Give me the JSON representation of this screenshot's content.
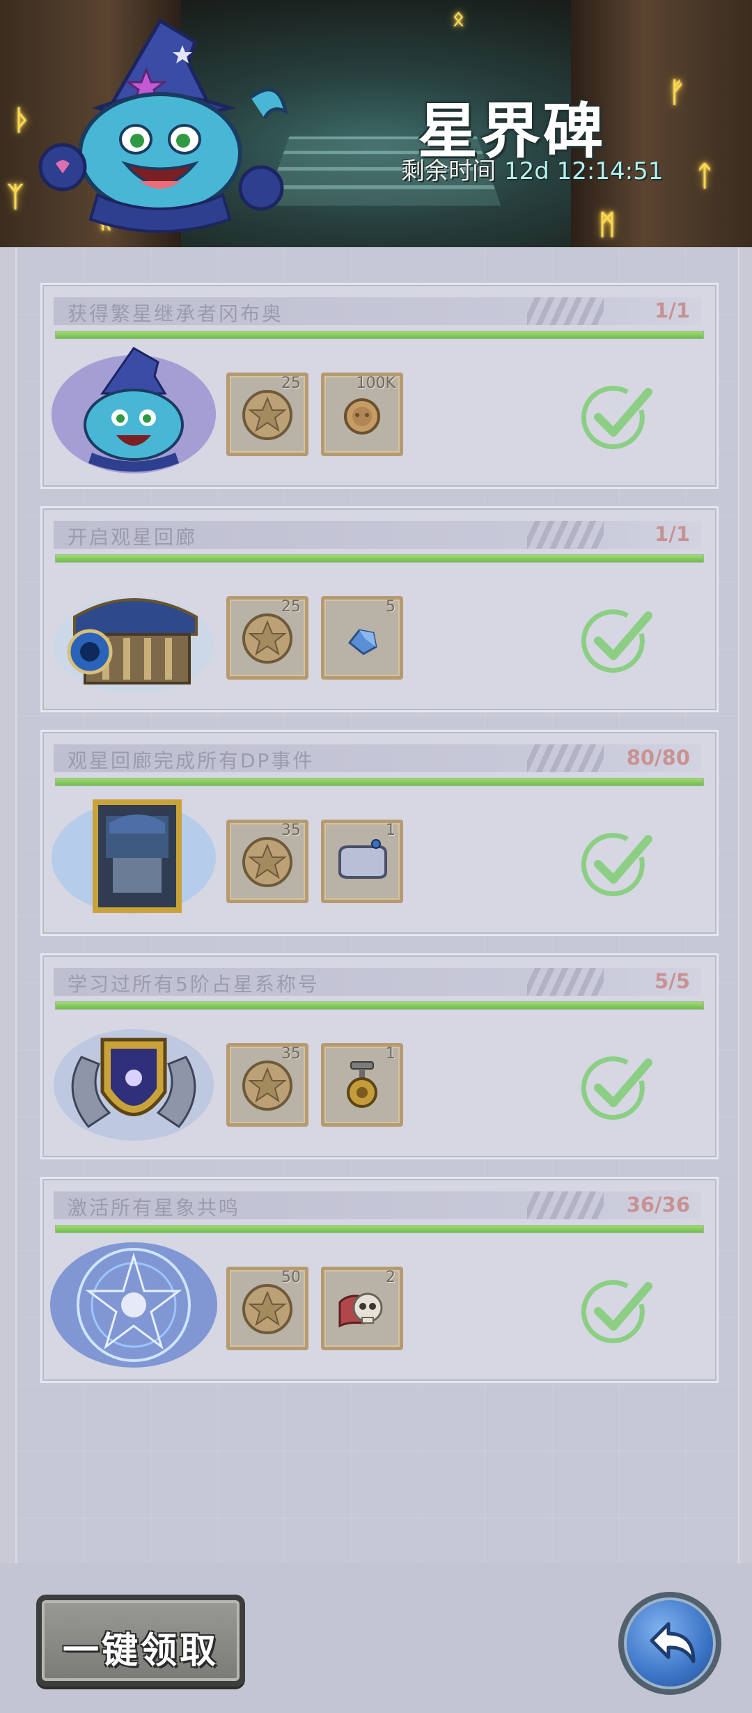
{
  "header": {
    "title": "星界碑",
    "timer_label": "剩余时间",
    "timer_value": "12d 12:14:51"
  },
  "colors": {
    "progress_green": "#7cc957",
    "count_red": "#c89292",
    "check_green": "#8ccf84",
    "accent_blue": "#3a72c4"
  },
  "quests": [
    {
      "title": "获得繁星继承者冈布奥",
      "progress": "1/1",
      "progress_fraction": 1.0,
      "thumb_icon": "wizard-cat-icon",
      "rewards": [
        {
          "icon": "star-coin-icon",
          "qty": "25"
        },
        {
          "icon": "gold-coin-icon",
          "qty": "100K"
        }
      ],
      "status_icon": "checkmark-icon"
    },
    {
      "title": "开启观星回廊",
      "progress": "1/1",
      "progress_fraction": 1.0,
      "thumb_icon": "portal-shrine-icon",
      "rewards": [
        {
          "icon": "star-coin-icon",
          "qty": "25"
        },
        {
          "icon": "crystal-icon",
          "qty": "5"
        }
      ],
      "status_icon": "checkmark-icon"
    },
    {
      "title": "观星回廊完成所有DP事件",
      "progress": "80/80",
      "progress_fraction": 1.0,
      "thumb_icon": "framed-card-icon",
      "rewards": [
        {
          "icon": "star-coin-icon",
          "qty": "35"
        },
        {
          "icon": "speech-bubble-frame-icon",
          "qty": "1"
        }
      ],
      "status_icon": "checkmark-icon"
    },
    {
      "title": "学习过所有5阶占星系称号",
      "progress": "5/5",
      "progress_fraction": 1.0,
      "thumb_icon": "winged-shield-icon",
      "rewards": [
        {
          "icon": "star-coin-icon",
          "qty": "35"
        },
        {
          "icon": "medal-icon",
          "qty": "1"
        }
      ],
      "status_icon": "checkmark-icon"
    },
    {
      "title": "激活所有星象共鸣",
      "progress": "36/36",
      "progress_fraction": 1.0,
      "thumb_icon": "magic-circle-icon",
      "rewards": [
        {
          "icon": "star-coin-icon",
          "qty": "50"
        },
        {
          "icon": "skull-scroll-icon",
          "qty": "2"
        }
      ],
      "status_icon": "checkmark-icon"
    }
  ],
  "footer": {
    "claim_all_label": "一键领取",
    "back_icon": "back-arrow-icon"
  }
}
